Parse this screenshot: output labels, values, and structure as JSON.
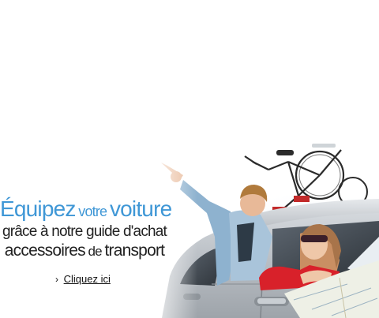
{
  "banner": {
    "headline": {
      "part1": "Équipez",
      "part2": "votre",
      "part3": "voiture"
    },
    "line2": "grâce à notre guide d'achat",
    "line3": {
      "part1": "accessoires",
      "part2": "de",
      "part3": "transport"
    },
    "cta": {
      "arrow": "›",
      "label": "Cliquez ici"
    },
    "colors": {
      "headline": "#3f97d6",
      "text": "#222222"
    },
    "photo": {
      "icon": "family-car-bicycle-photo"
    }
  }
}
